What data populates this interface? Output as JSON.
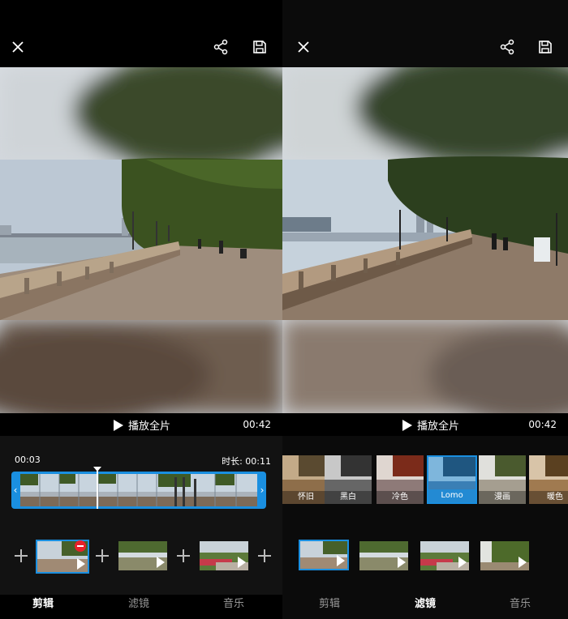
{
  "left": {
    "playbar": {
      "play_label": "播放全片",
      "duration": "00:42"
    },
    "timeline": {
      "current_time": "00:03",
      "clip_duration": "时长: 00:11"
    },
    "tabs": [
      "剪辑",
      "滤镜",
      "音乐"
    ],
    "active_tab": "剪辑"
  },
  "right": {
    "playbar": {
      "play_label": "播放全片",
      "duration": "00:42"
    },
    "filters": [
      "怀旧",
      "黑白",
      "冷色",
      "Lomo",
      "漫画",
      "暖色"
    ],
    "selected_filter": "Lomo",
    "tabs": [
      "剪辑",
      "滤镜",
      "音乐"
    ],
    "active_tab": "滤镜"
  },
  "colors": {
    "accent": "#1a8fe0",
    "delete": "#e8202a",
    "inactive_text": "#999999"
  },
  "icons": [
    "close-icon",
    "share-icon",
    "save-icon",
    "play-icon",
    "plus-icon",
    "delete-icon"
  ]
}
